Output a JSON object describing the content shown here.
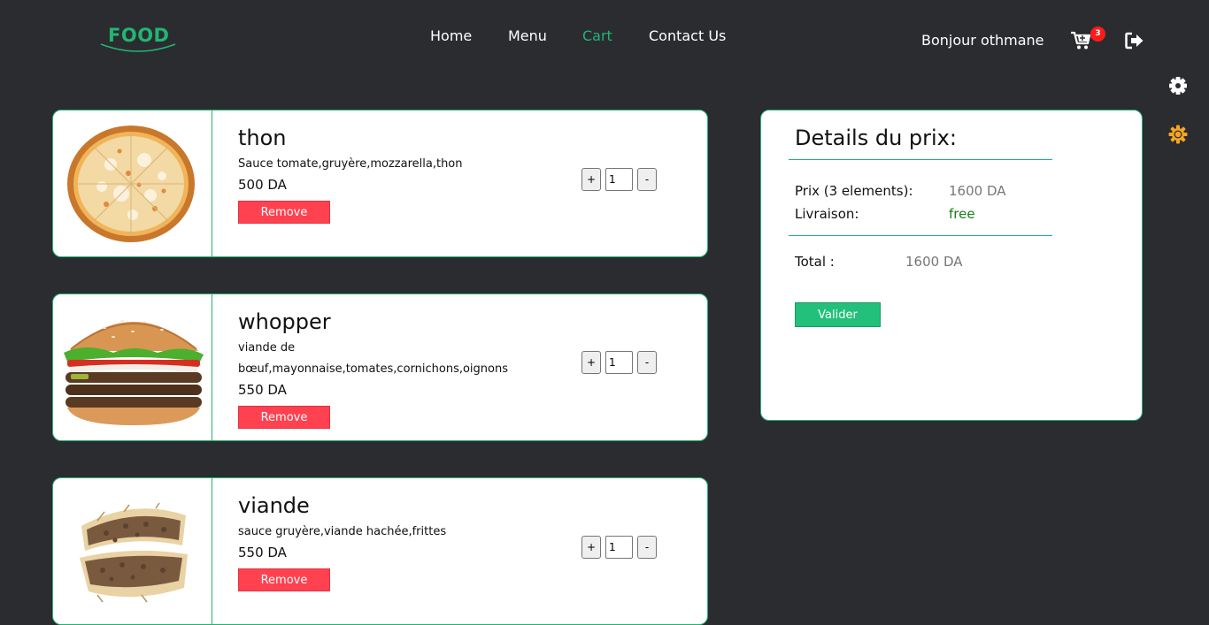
{
  "header": {
    "logo": "FOOD",
    "nav": [
      {
        "label": "Home",
        "active": false
      },
      {
        "label": "Menu",
        "active": false
      },
      {
        "label": "Cart",
        "active": true
      },
      {
        "label": "Contact Us",
        "active": false
      }
    ],
    "greeting": "Bonjour othmane",
    "cart_count": "3",
    "icons": [
      "cart-icon",
      "logout-icon"
    ]
  },
  "sidebar_icons": [
    "gear-icon",
    "sun-icon"
  ],
  "colors": {
    "background": "#2b2c30",
    "accent": "#22b573",
    "remove": "#ff4150",
    "valider": "#22c07a",
    "badge": "#ff1a1a",
    "theme_sun": "#f5a623"
  },
  "cart": {
    "items": [
      {
        "name": "thon",
        "description": "Sauce tomate,gruyère,mozzarella,thon",
        "price": "500 DA",
        "quantity": "1",
        "remove_label": "Remove",
        "plus_label": "+",
        "minus_label": "-",
        "image": "pizza"
      },
      {
        "name": "whopper",
        "description": "viande de bœuf,mayonnaise,tomates,cornichons,oignons",
        "price": "550 DA",
        "quantity": "1",
        "remove_label": "Remove",
        "plus_label": "+",
        "minus_label": "-",
        "image": "burger"
      },
      {
        "name": "viande",
        "description": "sauce gruyère,viande hachée,frittes",
        "price": "550 DA",
        "quantity": "1",
        "remove_label": "Remove",
        "plus_label": "+",
        "minus_label": "-",
        "image": "wrap"
      }
    ]
  },
  "price_details": {
    "title": "Details du prix:",
    "prix_label": "Prix (3 elements):",
    "prix_value": "1600 DA",
    "livraison_label": "Livraison:",
    "livraison_value": "free",
    "total_label": "Total :",
    "total_value": "1600 DA",
    "valider_label": "Valider"
  }
}
